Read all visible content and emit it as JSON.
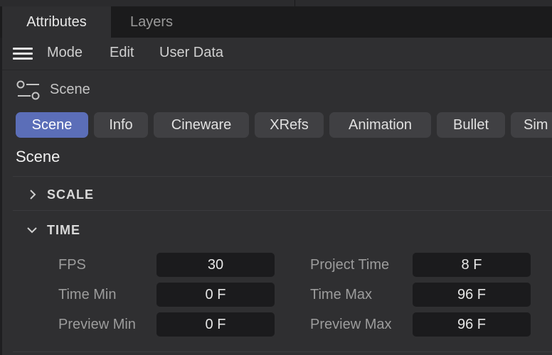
{
  "tabs": {
    "attributes": "Attributes",
    "layers": "Layers"
  },
  "menu": {
    "mode": "Mode",
    "edit": "Edit",
    "user_data": "User Data"
  },
  "object": {
    "title": "Scene"
  },
  "pills": [
    "Scene",
    "Info",
    "Cineware",
    "XRefs",
    "Animation",
    "Bullet",
    "Sim"
  ],
  "active_pill": "Scene",
  "section_title": "Scene",
  "groups": {
    "scale": {
      "label": "SCALE",
      "expanded": false
    },
    "time": {
      "label": "TIME",
      "expanded": true
    }
  },
  "params": {
    "fps": {
      "label": "FPS",
      "value": "30"
    },
    "project_time": {
      "label": "Project Time",
      "value": "8 F"
    },
    "time_min": {
      "label": "Time Min",
      "value": "0 F"
    },
    "time_max": {
      "label": "Time Max",
      "value": "96 F"
    },
    "preview_min": {
      "label": "Preview Min",
      "value": "0 F"
    },
    "preview_max": {
      "label": "Preview Max",
      "value": "96 F"
    }
  },
  "colors": {
    "accent": "#5b6eb8",
    "panel": "#2f2f31",
    "field": "#1b1b1d"
  }
}
